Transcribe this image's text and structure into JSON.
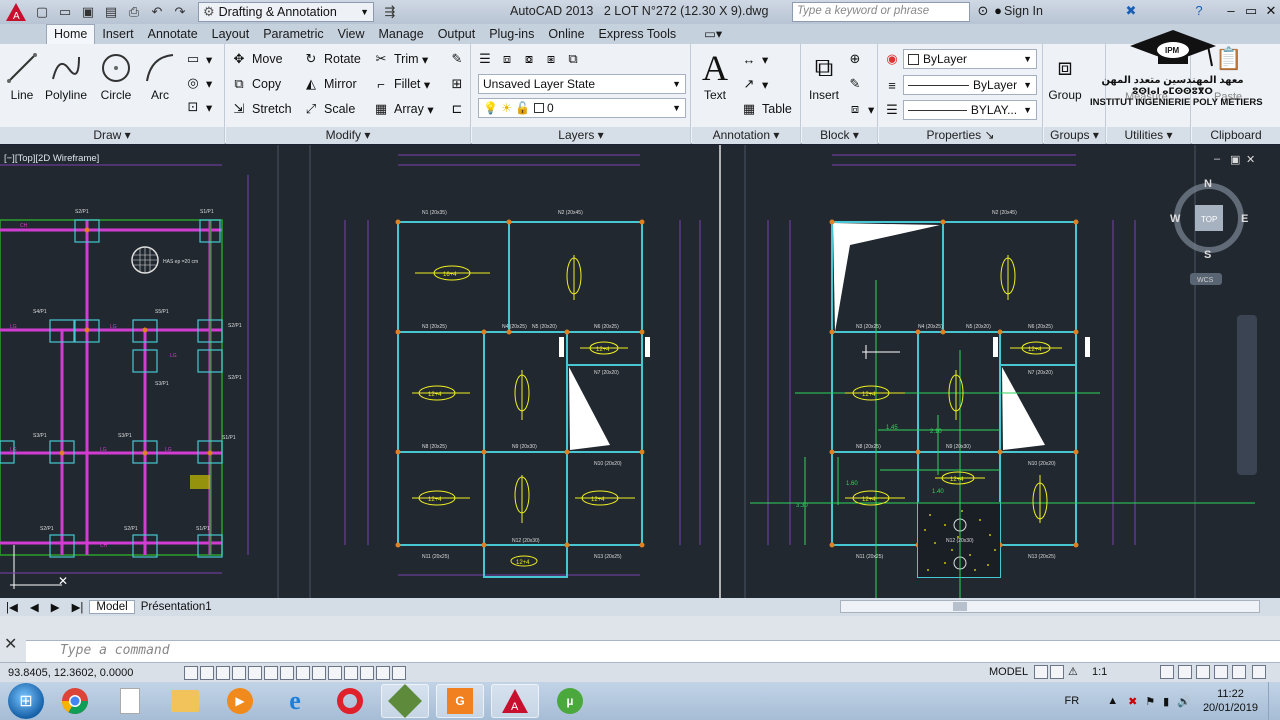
{
  "titlebar": {
    "workspace": "Drafting & Annotation",
    "app_name": "AutoCAD 2013",
    "file_name": "2 LOT N°272 (12.30 X 9).dwg",
    "search_placeholder": "Type a keyword or phrase",
    "signin": "Sign In"
  },
  "tabs": [
    "Home",
    "Insert",
    "Annotate",
    "Layout",
    "Parametric",
    "View",
    "Manage",
    "Output",
    "Plug-ins",
    "Online",
    "Express Tools"
  ],
  "ribbon": {
    "draw": {
      "label": "Draw",
      "line": "Line",
      "polyline": "Polyline",
      "circle": "Circle",
      "arc": "Arc"
    },
    "modify": {
      "label": "Modify",
      "move": "Move",
      "rotate": "Rotate",
      "trim": "Trim",
      "copy": "Copy",
      "mirror": "Mirror",
      "fillet": "Fillet",
      "stretch": "Stretch",
      "scale": "Scale",
      "array": "Array"
    },
    "layers": {
      "label": "Layers",
      "layer_state": "Unsaved Layer State",
      "current_layer": "0"
    },
    "annotation": {
      "label": "Annotation",
      "text": "Text",
      "table": "Table"
    },
    "block": {
      "label": "Block",
      "insert": "Insert"
    },
    "properties": {
      "label": "Properties",
      "color": "ByLayer",
      "linetype": "ByLayer",
      "lineweight": "BYLAY..."
    },
    "groups": {
      "label": "Groups",
      "group": "Group"
    },
    "utilities": {
      "label": "Utilities",
      "measure": "Measure"
    },
    "clipboard": {
      "label": "Clipboard",
      "paste": "Paste"
    }
  },
  "viewport": {
    "label": "[−][Top][2D Wireframe]"
  },
  "viewcube": {
    "n": "N",
    "s": "S",
    "e": "E",
    "w": "W",
    "top": "TOP",
    "wcs": "WCS"
  },
  "layout_tabs": [
    "Model",
    "Présentation1"
  ],
  "command": {
    "placeholder": "Type a command"
  },
  "status": {
    "coords": "93.8405, 12.3602, 0.0000",
    "model": "MODEL",
    "scale": "1:1"
  },
  "taskbar": {
    "lang": "FR",
    "time": "11:22",
    "date": "20/01/2019"
  },
  "logo": {
    "arabic": "معهد المهندسين متعدد المهن",
    "tifinagh": "ⵓⵙⵏⴰⵏ ⴰⵎⵙⵙⵓⴳⵔ",
    "french": "INSTITUT INGENIERIE POLY METIERS",
    "abbr": "IPM"
  },
  "drawing": {
    "beam_labels": [
      "N1 (20x35)",
      "N2 (20x45)",
      "N3 (20x25)",
      "N4 (20x25)",
      "N5 (20x20)",
      "N6 (20x25)",
      "N7 (20x20)",
      "N8 (20x25)",
      "N9 (20x30)",
      "N10 (20x20)",
      "N11 (20x25)",
      "N12 (20x30)",
      "N13 (20x25)"
    ],
    "slab_labels": [
      "16+4",
      "12+4",
      "12+4",
      "12+4",
      "12+4",
      "12+4",
      "12+4"
    ],
    "dims": [
      "1.45",
      "2.10",
      "1.40",
      "1.60",
      "3.30"
    ],
    "plan_labels": [
      "S2/P1",
      "S1/P1",
      "S3/P1",
      "S4/P1",
      "S5/P1",
      "CH",
      "LG",
      "HAS ep =20 cm"
    ]
  },
  "colors": {
    "accent": "#1a5fb4",
    "drawing_bg": "#212830",
    "beam": "#46c7d2",
    "slab_text": "#f0f020",
    "dim": "#2fd65a",
    "plan_beam": "#d33cd3"
  }
}
